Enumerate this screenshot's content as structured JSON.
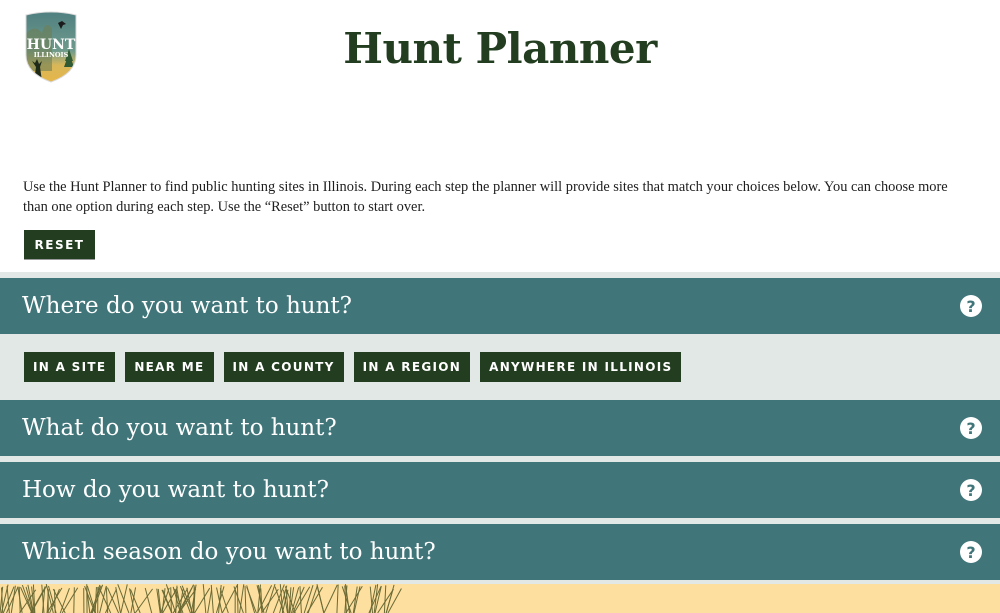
{
  "header": {
    "logo_text_line1": "HUNT",
    "logo_text_line2": "ILLINOIS",
    "title": "Hunt Planner"
  },
  "intro": {
    "text": "Use the Hunt Planner to find public hunting sites in Illinois. During each step the planner will provide sites that match your choices below. You can choose more than one option during each step. Use the “Reset” button to start over."
  },
  "reset_label": "RESET",
  "steps": [
    {
      "title": "Where do you want to hunt?",
      "help_icon": "question-circle-icon",
      "expanded": true,
      "options": [
        "IN A SITE",
        "NEAR ME",
        "IN A COUNTY",
        "IN A REGION",
        "ANYWHERE IN ILLINOIS"
      ]
    },
    {
      "title": "What do you want to hunt?",
      "help_icon": "question-circle-icon",
      "expanded": false
    },
    {
      "title": "How do you want to hunt?",
      "help_icon": "question-circle-icon",
      "expanded": false
    },
    {
      "title": "Which season do you want to hunt?",
      "help_icon": "question-circle-icon",
      "expanded": false
    }
  ],
  "colors": {
    "brand_dark_green": "#223d1f",
    "accordion_teal": "#40767a",
    "panel_gray": "#e2e8e6",
    "footer_tan": "#fddf9f",
    "grass": "#6b6a35"
  }
}
